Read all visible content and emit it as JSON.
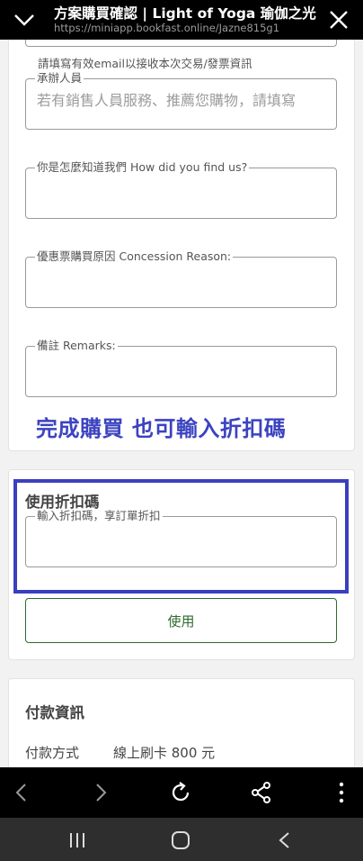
{
  "header": {
    "title": "方案購買確認 | Light of Yoga 瑜伽之光",
    "url": "https://miniapp.bookfast.online/Jazne815g1"
  },
  "form": {
    "email_helper": "請填寫有效email以接收本次交易/發票資訊",
    "sales_label": "承辦人員",
    "sales_placeholder": "若有銷售人員服務、推薦您購物，請填寫",
    "source_label": "你是怎麼知道我們 How did you find us?",
    "concession_label": "優惠票購買原因 Concession Reason:",
    "remarks_label": "備註 Remarks:"
  },
  "annotation": "完成購買 也可輸入折扣碼",
  "discount": {
    "title": "使用折扣碼",
    "input_label": "輸入折扣碼，享訂單折扣",
    "apply_label": "使用"
  },
  "payment": {
    "title": "付款資訊",
    "method_label": "付款方式",
    "method_value": "線上刷卡 800 元"
  },
  "colors": {
    "annotation": "#3b43c0",
    "highlight_border": "#3a3fbf",
    "apply_button": "#2e6b2e"
  },
  "icons": {
    "top_left": "chevron-down-icon",
    "top_right": "close-icon",
    "browser": [
      "back-arrow-icon",
      "forward-arrow-icon",
      "reload-icon",
      "share-icon",
      "more-vert-icon"
    ],
    "system": [
      "recent-apps-icon",
      "home-icon",
      "system-back-icon"
    ]
  }
}
